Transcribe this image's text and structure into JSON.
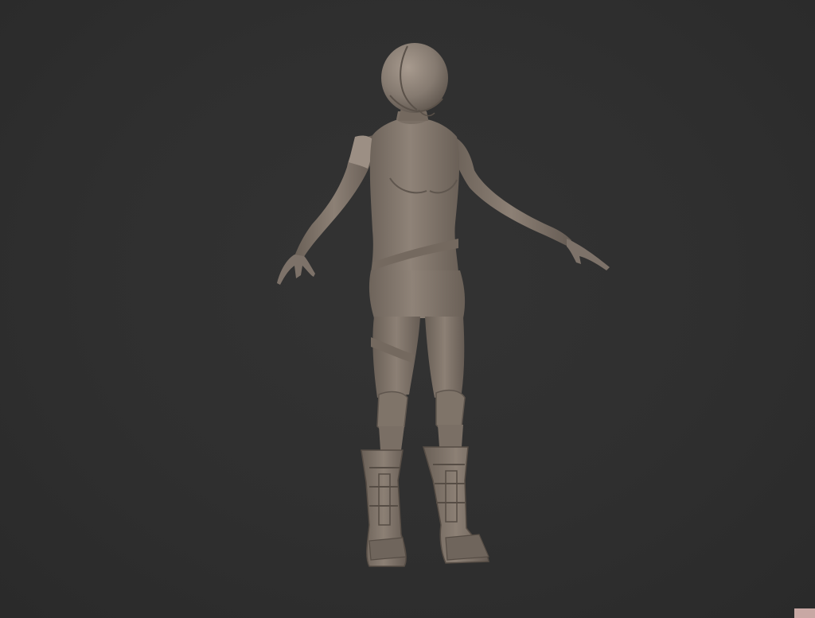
{
  "viewport": {
    "background_color": "#2e2e2e",
    "model_color": "#857a70",
    "model_shadow_color": "#5f564e",
    "model_highlight_color": "#a69a8f",
    "corner_swatch_color": "#c8a8a4"
  },
  "model": {
    "subject": "female-character-sculpt",
    "pose": "A-pose",
    "parts": [
      "helmet",
      "torso",
      "left-arm",
      "right-arm",
      "hips",
      "left-leg",
      "right-leg",
      "left-boot",
      "right-boot"
    ]
  }
}
